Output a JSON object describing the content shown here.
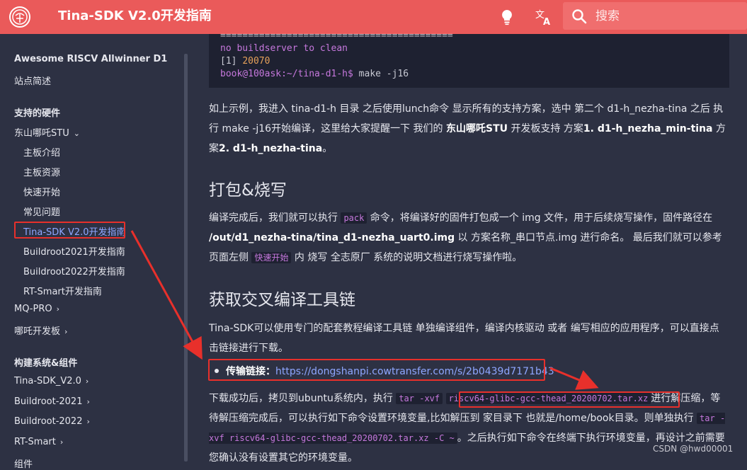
{
  "header": {
    "title": "Tina-SDK V2.0开发指南",
    "search_placeholder": "搜索",
    "icons": [
      "logo-icon",
      "lightbulb-icon",
      "translate-icon",
      "search-icon"
    ]
  },
  "sidebar": {
    "site_title": "Awesome RISCV Allwinner D1",
    "intro": "站点简述",
    "section_hw": "支持的硬件",
    "board_group": "东山哪吒STU",
    "board_items": [
      "主板介绍",
      "主板资源",
      "快速开始",
      "常见问题",
      "Tina-SDK V2.0开发指南",
      "Buildroot2021开发指南",
      "Buildroot2022开发指南",
      "RT-Smart开发指南"
    ],
    "groups": [
      "MQ-PRO",
      "哪吒开发板"
    ],
    "section_build": "构建系统&组件",
    "build_items": [
      "Tina-SDK_V2.0",
      "Buildroot-2021",
      "Buildroot-2022",
      "RT-Smart",
      "组件"
    ]
  },
  "code": {
    "separator": "==========================================",
    "line1": "no buildserver to clean",
    "line2_bracket": "[1]",
    "line2_pid": "20070",
    "prompt": "book@100ask:~/tina-d1-h$",
    "cmd": " make -j16"
  },
  "content": {
    "p1_a": "如上示例，我进入 tina-d1-h 目录 之后使用lunch命令 显示所有的支持方案，选中 第二个 d1-h_nezha-tina 之后 执行 make -j16开始编译，这里给大家提醒一下 我们的 ",
    "p1_b1": "东山哪吒STU",
    "p1_c": " 开发板支持 方案",
    "p1_b2": "1. d1-h_nezha_min-tina",
    "p1_d": " 方案",
    "p1_b3": "2. d1-h_nezha-tina",
    "p1_e": "。",
    "h_pack": "打包&烧写",
    "p2_a": "编译完成后，我们就可以执行 ",
    "p2_code": "pack",
    "p2_b": " 命令，将编译好的固件打包成一个 img 文件，用于后续烧写操作，固件路径在 ",
    "p2_bold": "/out/d1_nezha-tina/tina_d1-nezha_uart0.img",
    "p2_c": " 以 方案名称_串口节点.img 进行命名。 最后我们就可以参考页面左侧 ",
    "p2_code2": "快速开始",
    "p2_d": " 内 烧写 全志原厂 系统的说明文档进行烧写操作啦。",
    "h_toolchain": "获取交叉编译工具链",
    "p3": "Tina-SDK可以使用专门的配套教程编译工具链 单独编译组件，编译内核驱动 或者 编写相应的应用程序，可以直接点击链接进行下载。",
    "bullet_label": "传输链接：",
    "bullet_link": "https://dongshanpi.cowtransfer.com/s/2b0439d7171b43",
    "p4_a": "下载成功后，拷贝到ubuntu系统内，执行 ",
    "p4_code1": "tar -xvf",
    "p4_code2": "riscv64-glibc-gcc-thead_20200702.tar.xz",
    "p4_b": "进行解压缩，等待解压缩完成后，可以执行如下命令设置环境变量,比如解压到 家目录下 也就是/home/book目录。则单独执行 ",
    "p4_code3": "tar -xvf riscv64-glibc-gcc-thead_20200702.tar.xz -C ~",
    "p4_c": "。之后执行如下命令在终端下执行环境变量，再设计之前需要您确认没有设置其它的环境变量。"
  },
  "watermark": "CSDN @hwd00001",
  "colors": {
    "header": "#ea5a5a",
    "background": "#2d3143",
    "link": "#8ea6ff",
    "annotation": "#e8302b"
  }
}
